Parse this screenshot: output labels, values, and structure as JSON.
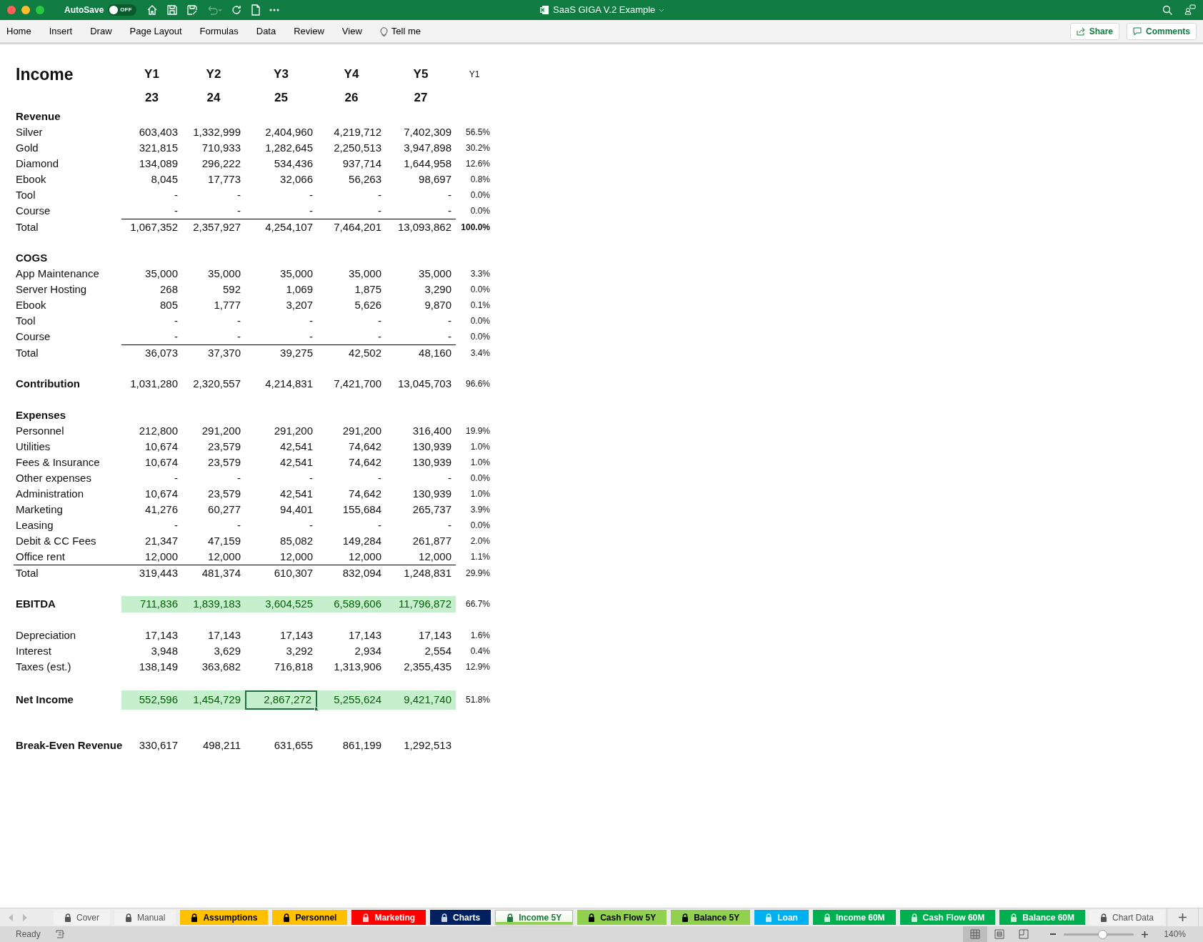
{
  "window": {
    "title": "SaaS GIGA V.2 Example",
    "autosave_label": "AutoSave",
    "autosave": {
      "on": false,
      "label": "OFF"
    }
  },
  "ribbon": {
    "tabs": [
      "Home",
      "Insert",
      "Draw",
      "Page Layout",
      "Formulas",
      "Data",
      "Review",
      "View"
    ],
    "tell_me": "Tell me",
    "share": "Share",
    "comments": "Comments"
  },
  "sheet": {
    "title": "Income",
    "years": [
      "Y1",
      "Y2",
      "Y3",
      "Y4",
      "Y5"
    ],
    "year_numbers": [
      "23",
      "24",
      "25",
      "26",
      "27"
    ],
    "pct_header": "Y1",
    "rows": [
      {
        "kind": "section",
        "label": "Revenue"
      },
      {
        "kind": "data",
        "label": "Silver",
        "values": [
          "603,403",
          "1,332,999",
          "2,404,960",
          "4,219,712",
          "7,402,309"
        ],
        "pct": "56.5%"
      },
      {
        "kind": "data",
        "label": "Gold",
        "values": [
          "321,815",
          "710,933",
          "1,282,645",
          "2,250,513",
          "3,947,898"
        ],
        "pct": "30.2%"
      },
      {
        "kind": "data",
        "label": "Diamond",
        "values": [
          "134,089",
          "296,222",
          "534,436",
          "937,714",
          "1,644,958"
        ],
        "pct": "12.6%"
      },
      {
        "kind": "data",
        "label": "Ebook",
        "values": [
          "8,045",
          "17,773",
          "32,066",
          "56,263",
          "98,697"
        ],
        "pct": "0.8%"
      },
      {
        "kind": "data",
        "label": "Tool",
        "values": [
          "-",
          "-",
          "-",
          "-",
          "-"
        ],
        "pct": "0.0%"
      },
      {
        "kind": "data",
        "label": "Course",
        "values": [
          "-",
          "-",
          "-",
          "-",
          "-"
        ],
        "pct": "0.0%"
      },
      {
        "kind": "total",
        "rule_under_label": false,
        "label": "Total",
        "values": [
          "1,067,352",
          "2,357,927",
          "4,254,107",
          "7,464,201",
          "13,093,862"
        ],
        "pct": "100.0%",
        "pct_bold": true
      },
      {
        "kind": "spacer"
      },
      {
        "kind": "section",
        "label": "COGS"
      },
      {
        "kind": "data",
        "label": "App Maintenance",
        "values": [
          "35,000",
          "35,000",
          "35,000",
          "35,000",
          "35,000"
        ],
        "pct": "3.3%"
      },
      {
        "kind": "data",
        "label": "Server Hosting",
        "values": [
          "268",
          "592",
          "1,069",
          "1,875",
          "3,290"
        ],
        "pct": "0.0%"
      },
      {
        "kind": "data",
        "label": "Ebook",
        "values": [
          "805",
          "1,777",
          "3,207",
          "5,626",
          "9,870"
        ],
        "pct": "0.1%"
      },
      {
        "kind": "data",
        "label": "Tool",
        "values": [
          "-",
          "-",
          "-",
          "-",
          "-"
        ],
        "pct": "0.0%"
      },
      {
        "kind": "data",
        "label": "Course",
        "values": [
          "-",
          "-",
          "-",
          "-",
          "-"
        ],
        "pct": "0.0%"
      },
      {
        "kind": "total",
        "rule_under_label": false,
        "label": "Total",
        "values": [
          "36,073",
          "37,370",
          "39,275",
          "42,502",
          "48,160"
        ],
        "pct": "3.4%",
        "pct_bold": false
      },
      {
        "kind": "spacer"
      },
      {
        "kind": "summary",
        "label": "Contribution",
        "values": [
          "1,031,280",
          "2,320,557",
          "4,214,831",
          "7,421,700",
          "13,045,703"
        ],
        "pct": "96.6%"
      },
      {
        "kind": "spacer"
      },
      {
        "kind": "section",
        "label": "Expenses"
      },
      {
        "kind": "data",
        "label": "Personnel",
        "values": [
          "212,800",
          "291,200",
          "291,200",
          "291,200",
          "316,400"
        ],
        "pct": "19.9%"
      },
      {
        "kind": "data",
        "label": "Utilities",
        "values": [
          "10,674",
          "23,579",
          "42,541",
          "74,642",
          "130,939"
        ],
        "pct": "1.0%"
      },
      {
        "kind": "data",
        "label": "Fees & Insurance",
        "values": [
          "10,674",
          "23,579",
          "42,541",
          "74,642",
          "130,939"
        ],
        "pct": "1.0%"
      },
      {
        "kind": "data",
        "label": "Other expenses",
        "values": [
          "-",
          "-",
          "-",
          "-",
          "-"
        ],
        "pct": "0.0%"
      },
      {
        "kind": "data",
        "label": "Administration",
        "values": [
          "10,674",
          "23,579",
          "42,541",
          "74,642",
          "130,939"
        ],
        "pct": "1.0%"
      },
      {
        "kind": "data",
        "label": "Marketing",
        "values": [
          "41,276",
          "60,277",
          "94,401",
          "155,684",
          "265,737"
        ],
        "pct": "3.9%"
      },
      {
        "kind": "data",
        "label": "Leasing",
        "values": [
          "-",
          "-",
          "-",
          "-",
          "-"
        ],
        "pct": "0.0%"
      },
      {
        "kind": "data",
        "label": "Debit & CC Fees",
        "values": [
          "21,347",
          "47,159",
          "85,082",
          "149,284",
          "261,877"
        ],
        "pct": "2.0%"
      },
      {
        "kind": "data",
        "label": "Office rent",
        "values": [
          "12,000",
          "12,000",
          "12,000",
          "12,000",
          "12,000"
        ],
        "pct": "1.1%"
      },
      {
        "kind": "total",
        "rule_under_label": true,
        "label": "Total",
        "values": [
          "319,443",
          "481,374",
          "610,307",
          "832,094",
          "1,248,831"
        ],
        "pct": "29.9%",
        "pct_bold": false
      },
      {
        "kind": "spacer"
      },
      {
        "kind": "highlight",
        "label": "EBITDA",
        "cells": [
          {
            "value": "711,836",
            "selected": false
          },
          {
            "value": "1,839,183",
            "selected": false
          },
          {
            "value": "3,604,525",
            "selected": false
          },
          {
            "value": "6,589,606",
            "selected": false
          },
          {
            "value": "11,796,872",
            "selected": false
          }
        ],
        "pct": "66.7%"
      },
      {
        "kind": "spacer"
      },
      {
        "kind": "data",
        "label": "Depreciation",
        "values": [
          "17,143",
          "17,143",
          "17,143",
          "17,143",
          "17,143"
        ],
        "pct": "1.6%"
      },
      {
        "kind": "data",
        "label": "Interest",
        "values": [
          "3,948",
          "3,629",
          "3,292",
          "2,934",
          "2,554"
        ],
        "pct": "0.4%"
      },
      {
        "kind": "data",
        "label": "Taxes (est.)",
        "values": [
          "138,149",
          "363,682",
          "716,818",
          "1,313,906",
          "2,355,435"
        ],
        "pct": "12.9%"
      },
      {
        "kind": "spacer"
      },
      {
        "kind": "highlight",
        "label": "Net Income",
        "cells": [
          {
            "value": "552,596",
            "selected": false
          },
          {
            "value": "1,454,729",
            "selected": false
          },
          {
            "value": "2,867,272",
            "selected": true
          },
          {
            "value": "5,255,624",
            "selected": false
          },
          {
            "value": "9,421,740",
            "selected": false
          }
        ],
        "pct": "51.8%"
      },
      {
        "kind": "spacer"
      },
      {
        "kind": "spacer"
      },
      {
        "kind": "summary",
        "label": "Break-Even Revenue",
        "values": [
          "330,617",
          "498,211",
          "631,655",
          "861,199",
          "1,292,513"
        ]
      }
    ]
  },
  "sheet_tabs": [
    {
      "label": "Cover",
      "color": "#f2f2f2",
      "selected": false
    },
    {
      "label": "Manual",
      "color": "#f2f2f2",
      "selected": false
    },
    {
      "label": "Assumptions",
      "color": "#ffc000",
      "selected": false
    },
    {
      "label": "Personnel",
      "color": "#ffc000",
      "selected": false
    },
    {
      "label": "Marketing",
      "color": "#ff0000",
      "selected": false
    },
    {
      "label": "Charts",
      "color": "#002060",
      "selected": false
    },
    {
      "label": "Income 5Y",
      "color": "#92d050",
      "selected": true
    },
    {
      "label": "Cash Flow 5Y",
      "color": "#92d050",
      "selected": false
    },
    {
      "label": "Balance 5Y",
      "color": "#92d050",
      "selected": false
    },
    {
      "label": "Loan",
      "color": "#00b0f0",
      "selected": false
    },
    {
      "label": "Income 60M",
      "color": "#00b050",
      "selected": false
    },
    {
      "label": "Cash Flow 60M",
      "color": "#00b050",
      "selected": false
    },
    {
      "label": "Balance 60M",
      "color": "#00b050",
      "selected": false
    },
    {
      "label": "Chart Data",
      "color": "#f2f2f2",
      "selected": false
    }
  ],
  "status_bar": {
    "status": "Ready",
    "views": [
      {
        "kind": "normal",
        "selected": true
      },
      {
        "kind": "page_layout",
        "selected": false
      },
      {
        "kind": "page_break",
        "selected": false
      }
    ],
    "zoom": {
      "level": 0.55,
      "label": "140%"
    }
  }
}
